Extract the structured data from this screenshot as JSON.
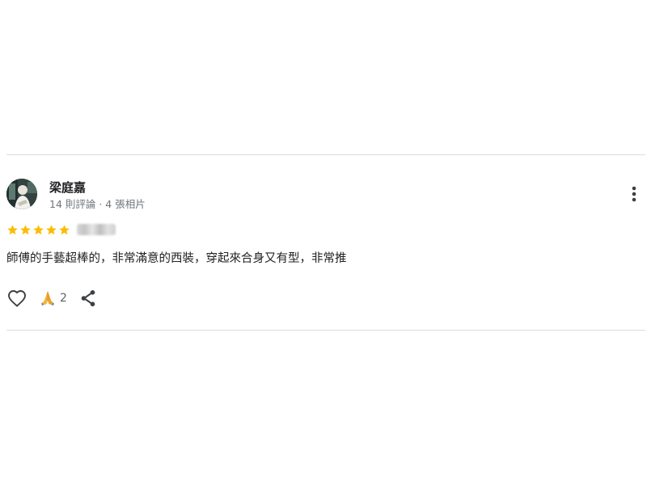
{
  "review": {
    "reviewer": {
      "name": "梁庭嘉",
      "meta": "14 則評論 · 4 張相片",
      "avatar_icon": "user-avatar-photo"
    },
    "rating": {
      "stars": 5,
      "max_stars": 5,
      "star_color": "#fbbc04",
      "date_blurred": true
    },
    "text": "師傅的手藝超棒的，非常滿意的西裝，穿起來合身又有型，非常推",
    "actions": {
      "like_icon": "heart-outline-icon",
      "reaction_icon": "praying-hands-icon",
      "reaction_count": "2",
      "share_icon": "share-icon"
    },
    "more_icon": "more-vertical-icon"
  },
  "colors": {
    "divider": "#dadce0",
    "text_primary": "#202124",
    "text_secondary": "#70757a",
    "icon": "#3c4043"
  }
}
